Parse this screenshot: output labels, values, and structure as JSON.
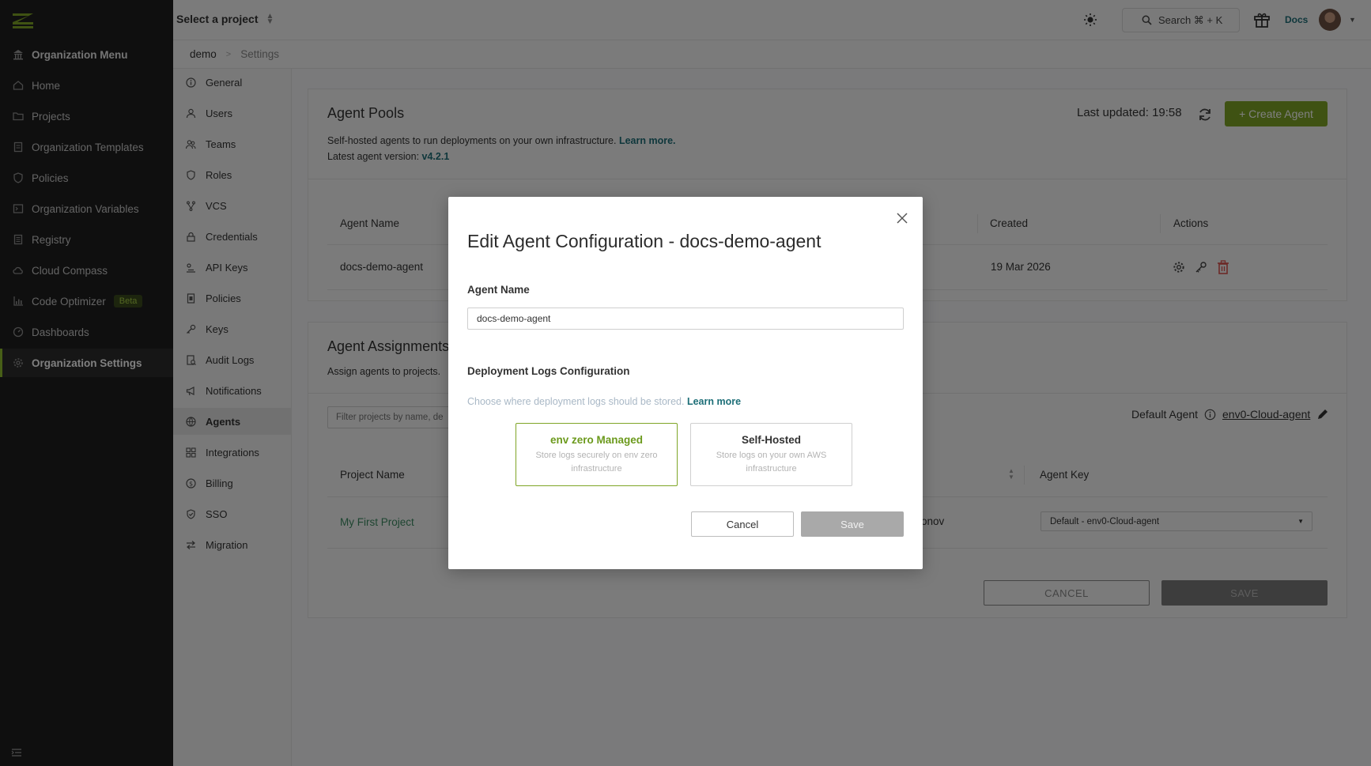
{
  "topbar": {
    "org_name": "demo",
    "project_selector": "Select a project",
    "search_label": "Search ⌘ + K",
    "docs_label": "Docs"
  },
  "sidebar": {
    "header": "Organization Menu",
    "items": [
      {
        "label": "Home",
        "icon": "home-icon"
      },
      {
        "label": "Projects",
        "icon": "folder-icon"
      },
      {
        "label": "Organization Templates",
        "icon": "template-icon"
      },
      {
        "label": "Policies",
        "icon": "shield-icon"
      },
      {
        "label": "Organization Variables",
        "icon": "variables-icon"
      },
      {
        "label": "Registry",
        "icon": "registry-icon"
      },
      {
        "label": "Cloud Compass",
        "icon": "cloud-icon"
      },
      {
        "label": "Code Optimizer",
        "icon": "chart-icon",
        "badge": "Beta"
      },
      {
        "label": "Dashboards",
        "icon": "dashboard-icon"
      },
      {
        "label": "Organization Settings",
        "icon": "gear-icon",
        "active": true
      }
    ]
  },
  "breadcrumb": {
    "first": "demo",
    "second": "Settings"
  },
  "settings_menu": [
    {
      "label": "General",
      "icon": "info-icon"
    },
    {
      "label": "Users",
      "icon": "user-icon"
    },
    {
      "label": "Teams",
      "icon": "team-icon"
    },
    {
      "label": "Roles",
      "icon": "role-icon"
    },
    {
      "label": "VCS",
      "icon": "vcs-icon"
    },
    {
      "label": "Credentials",
      "icon": "lock-icon"
    },
    {
      "label": "API Keys",
      "icon": "api-key-icon"
    },
    {
      "label": "Policies",
      "icon": "policy-icon"
    },
    {
      "label": "Keys",
      "icon": "key-icon"
    },
    {
      "label": "Audit Logs",
      "icon": "audit-icon"
    },
    {
      "label": "Notifications",
      "icon": "megaphone-icon"
    },
    {
      "label": "Agents",
      "icon": "agent-icon",
      "active": true
    },
    {
      "label": "Integrations",
      "icon": "grid-icon"
    },
    {
      "label": "Billing",
      "icon": "dollar-icon"
    },
    {
      "label": "SSO",
      "icon": "sso-icon"
    },
    {
      "label": "Migration",
      "icon": "migration-icon"
    }
  ],
  "agent_pools": {
    "title": "Agent Pools",
    "description": "Self-hosted agents to run deployments on your own infrastructure.",
    "learn_more": "Learn more.",
    "version_label": "Latest agent version:",
    "version": "v4.2.1",
    "last_updated": "Last updated: 19:58",
    "create_button": "+ Create Agent",
    "columns": {
      "name": "Agent Name",
      "created": "Created",
      "actions": "Actions"
    },
    "row": {
      "name": "docs-demo-agent",
      "created": "19 Mar 2026"
    }
  },
  "agent_assignments": {
    "title": "Agent Assignments",
    "description": "Assign agents to projects.",
    "filter_placeholder": "Filter projects by name, de",
    "default_agent_label": "Default Agent",
    "default_agent_value": "env0-Cloud-agent",
    "columns": {
      "project": "Project Name",
      "agent_key": "Agent Key"
    },
    "row": {
      "project": "My First Project",
      "partial": "onov",
      "agent_key": "Default - env0-Cloud-agent"
    },
    "cancel": "CANCEL",
    "save": "SAVE"
  },
  "modal": {
    "title": "Edit Agent Configuration - docs-demo-agent",
    "agent_name_label": "Agent Name",
    "agent_name_value": "docs-demo-agent",
    "logs_label": "Deployment Logs Configuration",
    "logs_helper": "Choose where deployment logs should be stored.",
    "logs_learn_more": "Learn more",
    "options": [
      {
        "title": "env zero Managed",
        "desc": "Store logs securely on env zero infrastructure",
        "selected": true
      },
      {
        "title": "Self-Hosted",
        "desc": "Store logs on your own AWS infrastructure",
        "selected": false
      }
    ],
    "cancel": "Cancel",
    "save": "Save"
  },
  "colors": {
    "accent": "#7fa526",
    "link": "#1e6f78",
    "sidebar": "#1e1e1e",
    "delete": "#d9534f"
  }
}
